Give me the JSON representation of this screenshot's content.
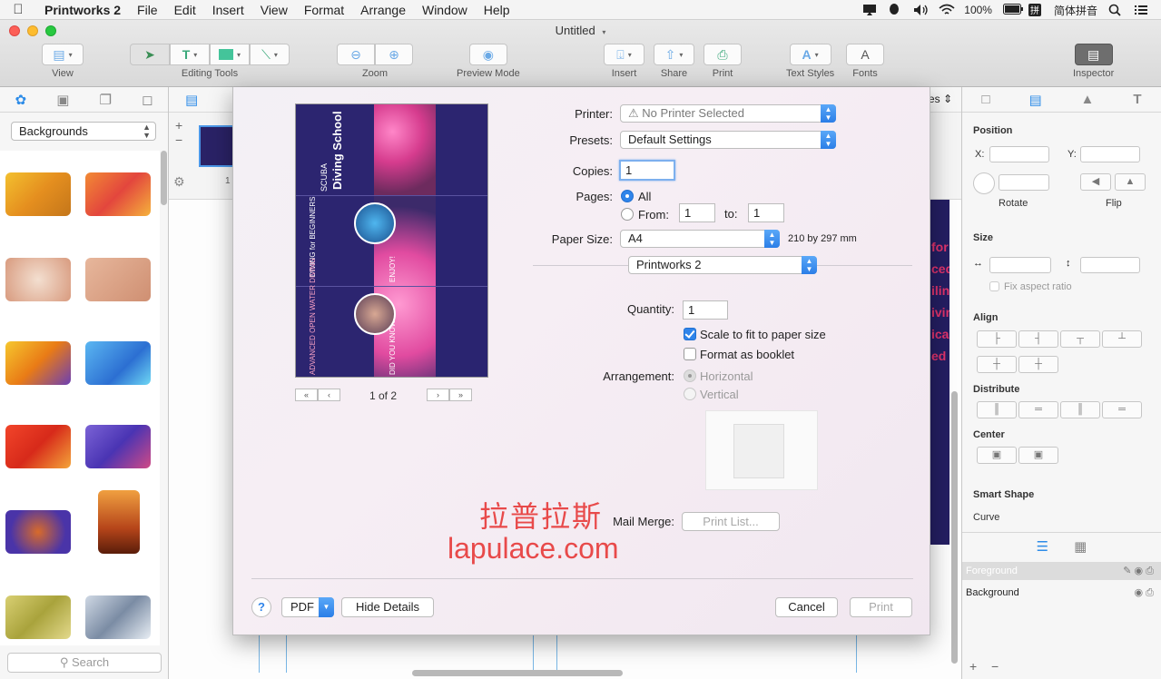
{
  "menubar": {
    "apple_icon": "apple-icon",
    "app_name": "Printworks 2",
    "items": [
      "File",
      "Edit",
      "Insert",
      "View",
      "Format",
      "Arrange",
      "Window",
      "Help"
    ],
    "battery": "100%",
    "input_method": "简体拼音"
  },
  "window": {
    "title": "Untitled"
  },
  "toolbar": {
    "view": "View",
    "editing_tools": "Editing Tools",
    "zoom": "Zoom",
    "preview_mode": "Preview Mode",
    "insert": "Insert",
    "share": "Share",
    "print": "Print",
    "text_styles": "Text Styles",
    "fonts": "Fonts",
    "inspector": "Inspector"
  },
  "left_panel": {
    "category": "Backgrounds",
    "search_placeholder": "Search",
    "thumbnail_colors": [
      [
        "#e8a92a",
        "#ec6a3a"
      ],
      [
        "#e9c7b2",
        "#d99a7b"
      ],
      [
        "#ef9d23",
        "#3c8fdb"
      ],
      [
        "#e8472a",
        "#6a55c7"
      ],
      [
        "#5d3fa8",
        "#e06a1a"
      ],
      [
        "#b7b048",
        "#a4b3c7"
      ]
    ]
  },
  "canvas": {
    "page_number": "1",
    "view_suffix": "es",
    "page_text_lines": [
      "for",
      "ced",
      "ilin",
      "ivin",
      "ical",
      "ed"
    ]
  },
  "inspector": {
    "position": "Position",
    "x": "X:",
    "y": "Y:",
    "rotate": "Rotate",
    "flip": "Flip",
    "size": "Size",
    "fix_aspect": "Fix aspect ratio",
    "align": "Align",
    "distribute": "Distribute",
    "center": "Center",
    "smart_shape": "Smart Shape",
    "curve": "Curve",
    "layers": [
      "Foreground",
      "Background"
    ]
  },
  "dialog": {
    "preview": {
      "title_small": "SCUBA",
      "title_big": "Diving School",
      "beginners": "DIVING for BEGINNERS",
      "advanced": "ADVANCED OPEN WATER DIVING",
      "did_you_know": "DID YOU KNOW...?",
      "enjoy": "ENJOY!",
      "page_indicator": "1 of 2"
    },
    "printer_label": "Printer:",
    "printer_value": "No Printer Selected",
    "presets_label": "Presets:",
    "presets_value": "Default Settings",
    "copies_label": "Copies:",
    "copies_value": "1",
    "pages_label": "Pages:",
    "pages_all": "All",
    "pages_from": "From:",
    "pages_from_value": "1",
    "pages_to": "to:",
    "pages_to_value": "1",
    "paper_size_label": "Paper Size:",
    "paper_size_value": "A4",
    "paper_dimensions": "210 by 297 mm",
    "section_value": "Printworks 2",
    "quantity_label": "Quantity:",
    "quantity_value": "1",
    "scale_to_fit": "Scale to fit to paper size",
    "format_booklet": "Format as booklet",
    "arrangement_label": "Arrangement:",
    "arrangement_horizontal": "Horizontal",
    "arrangement_vertical": "Vertical",
    "mail_merge_label": "Mail Merge:",
    "print_list_button": "Print List...",
    "help": "?",
    "pdf": "PDF",
    "hide_details": "Hide Details",
    "cancel": "Cancel",
    "print": "Print",
    "watermark_cn": "拉普拉斯",
    "watermark_en": "lapulace.com"
  }
}
